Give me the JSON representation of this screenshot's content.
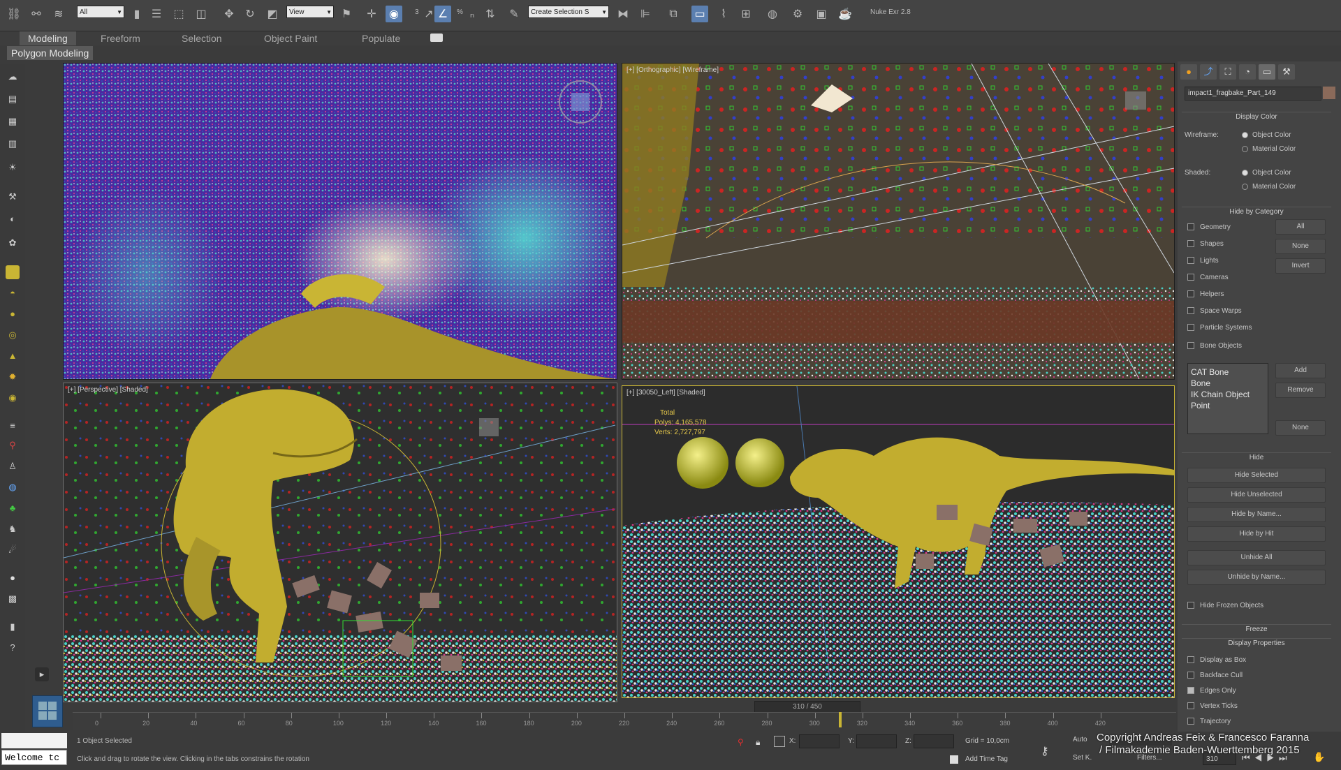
{
  "toolbar": {
    "selection_filter": "All",
    "ref_coord": "View",
    "named_selection": "Create Selection S",
    "plugin_label": "Nuke Exr 2.8",
    "snap_labels": [
      "3",
      "%"
    ],
    "icons": [
      "link-icon",
      "unlink-icon",
      "bind-spacewarp-icon",
      "select-object-icon",
      "select-by-name-icon",
      "rect-region-icon",
      "window-crossing-icon",
      "move-icon",
      "rotate-icon",
      "scale-icon",
      "pivot-icon",
      "select-manipulate-icon",
      "keyboard-shortcut-icon",
      "snap-toggle-icon",
      "angle-snap-icon",
      "percent-snap-icon",
      "spinner-snap-icon",
      "edit-named-sel-icon",
      "mirror-icon",
      "align-icon",
      "layer-explorer-icon",
      "toggle-ribbon-icon",
      "curve-editor-icon",
      "schematic-view-icon",
      "material-editor-icon",
      "render-setup-icon",
      "rendered-frame-icon",
      "render-icon"
    ]
  },
  "ribbon": {
    "tabs": [
      "Modeling",
      "Freeform",
      "Selection",
      "Object Paint",
      "Populate"
    ],
    "active_tab": "Modeling",
    "sub_label": "Polygon Modeling"
  },
  "viewports": {
    "top_left": {
      "label": ""
    },
    "top_right": {
      "label": "[+] [Orthographic] [Wireframe]"
    },
    "bottom_left": {
      "label": "[+] [Perspective] [Shaded]"
    },
    "bottom_right": {
      "label": "[+] [30050_Left] [Shaded]",
      "stats": {
        "total_label": "Total",
        "polys_label": "Polys:",
        "polys": "4,165,578",
        "verts_label": "Verts:",
        "verts": "2,727,797"
      }
    }
  },
  "command_panel": {
    "object_name": "impact1_fragbake_Part_149",
    "display_color": {
      "header": "Display Color",
      "wireframe_label": "Wireframe:",
      "shaded_label": "Shaded:",
      "options": [
        "Object Color",
        "Material Color"
      ]
    },
    "hide_by_category": {
      "header": "Hide by Category",
      "items": [
        "Geometry",
        "Shapes",
        "Lights",
        "Cameras",
        "Helpers",
        "Space Warps",
        "Particle Systems",
        "Bone Objects"
      ],
      "buttons": [
        "All",
        "None",
        "Invert"
      ],
      "list": [
        "CAT Bone",
        "Bone",
        "IK Chain Object",
        "Point"
      ],
      "list_buttons": [
        "Add",
        "Remove",
        "None"
      ]
    },
    "hide": {
      "header": "Hide",
      "buttons": [
        "Hide Selected",
        "Hide Unselected",
        "Hide by Name...",
        "Hide by Hit",
        "Unhide All",
        "Unhide by Name..."
      ],
      "frozen_label": "Hide Frozen Objects"
    },
    "freeze": {
      "header": "Freeze"
    },
    "display_properties": {
      "header": "Display Properties",
      "items": [
        "Display as Box",
        "Backface Cull",
        "Edges Only",
        "Vertex Ticks",
        "Trajectory"
      ]
    }
  },
  "timeline": {
    "frame_indicator": "310 / 450",
    "ticks": [
      "0",
      "20",
      "40",
      "60",
      "80",
      "100",
      "120",
      "140",
      "160",
      "180",
      "200",
      "220",
      "240",
      "260",
      "280",
      "300",
      "320",
      "340",
      "360",
      "380",
      "400",
      "420"
    ],
    "current_frame": 310,
    "total_frames": 450
  },
  "status": {
    "maxscript": "Welcome tc",
    "selected": "1 Object Selected",
    "prompt": "Click and drag to rotate the view.  Clicking in the tabs constrains the rotation",
    "x_label": "X:",
    "y_label": "Y:",
    "z_label": "Z:",
    "grid": "Grid = 10,0cm",
    "auto_label": "Auto",
    "setk_label": "Set K.",
    "filters_label": "Filters...",
    "add_time_tag": "Add Time Tag",
    "frame_field": "310"
  },
  "copyright": {
    "line1": "Copyright Andreas Feix & Francesco Faranna",
    "line2": "/ Filmakademie Baden-Wuerttemberg 2015"
  },
  "colors": {
    "accent": "#5b7fb0",
    "creature": "#c9b534",
    "viewport_bg": "#2f2f2f"
  }
}
